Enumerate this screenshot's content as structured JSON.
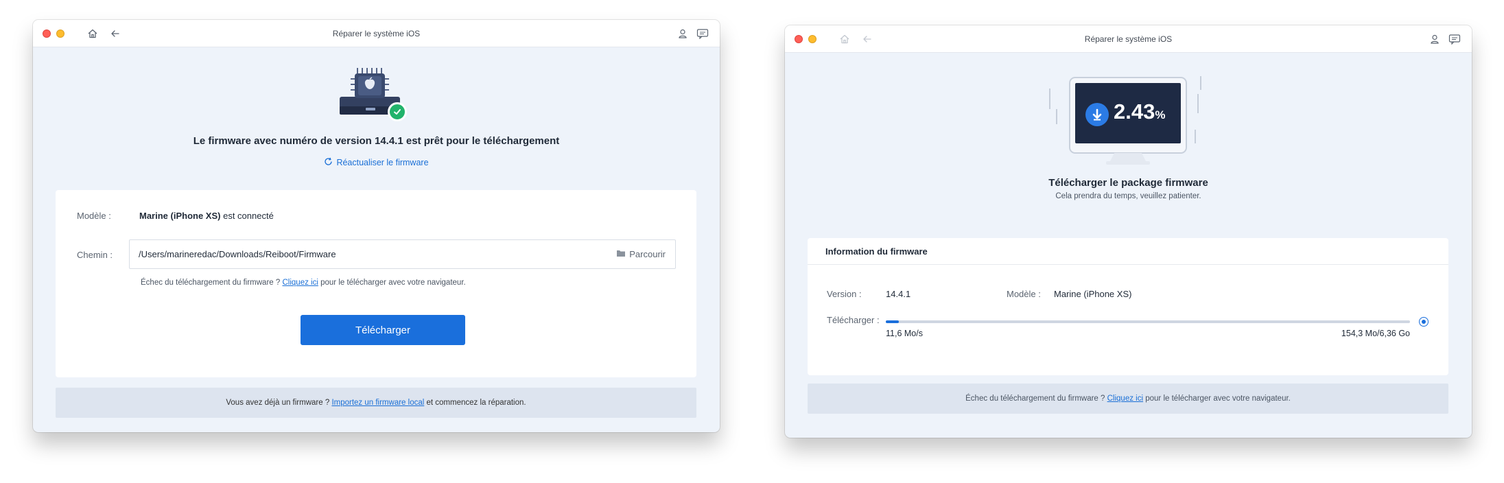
{
  "left_window": {
    "title": "Réparer le système iOS",
    "heading": "Le firmware avec numéro de version 14.4.1 est prêt pour le téléchargement",
    "refresh_label": "Réactualiser le firmware",
    "model_label": "Modèle :",
    "model_name": "Marine (iPhone XS)",
    "model_status": "est connecté",
    "path_label": "Chemin :",
    "path_value": "/Users/marineredac/Downloads/Reiboot/Firmware",
    "browse_label": "Parcourir",
    "fail_text": "Échec du téléchargement du firmware ?",
    "fail_link": "Cliquez ici",
    "fail_text_after": "pour le télécharger avec votre navigateur.",
    "download_button": "Télécharger",
    "footer_text_before": "Vous avez déjà un firmware ?",
    "footer_link": "Importez un firmware local",
    "footer_text_after": "et commencez la réparation."
  },
  "right_window": {
    "title": "Réparer le système iOS",
    "progress_percent_number": "2.43",
    "progress_percent_sign": "%",
    "heading": "Télécharger le package firmware",
    "subheading": "Cela prendra du temps, veuillez patienter.",
    "info_title": "Information du firmware",
    "version_label": "Version :",
    "version_value": "14.4.1",
    "model_label": "Modèle :",
    "model_value": "Marine (iPhone XS)",
    "download_label": "Télécharger :",
    "progress_fraction": 0.0243,
    "speed": "11,6 Mo/s",
    "size": "154,3 Mo/6,36 Go",
    "fail_text": "Échec du téléchargement du firmware ?",
    "fail_link": "Cliquez ici",
    "fail_text_after": "pour le télécharger avec votre navigateur."
  },
  "colors": {
    "accent": "#1a6fdc",
    "success": "#22b36b",
    "screen": "#1e2a44"
  },
  "icons": {
    "home": "home-icon",
    "back": "back-arrow-icon",
    "user": "user-icon",
    "feedback": "chat-icon",
    "refresh": "refresh-icon",
    "folder": "folder-icon",
    "download": "download-arrow-icon",
    "check": "check-icon"
  }
}
